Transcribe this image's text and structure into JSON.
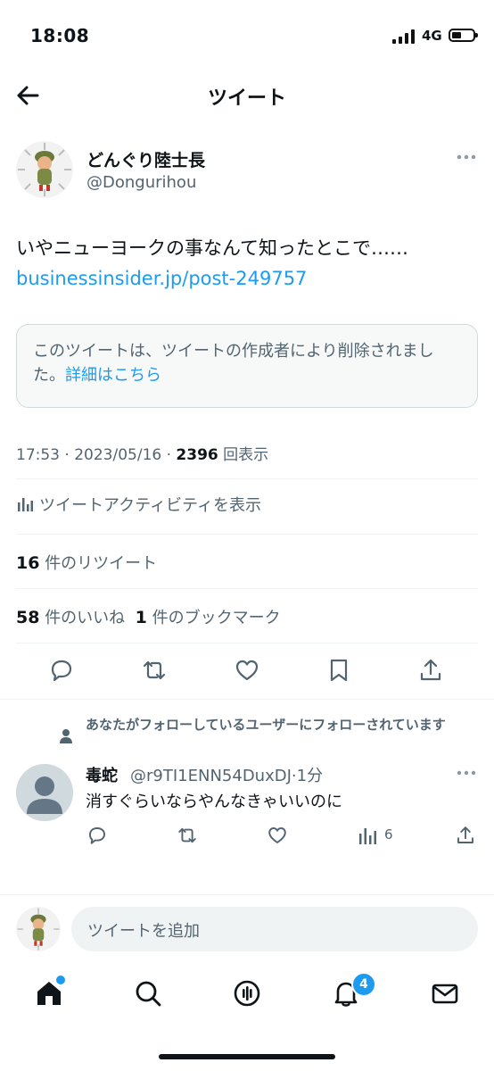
{
  "status_bar": {
    "time": "18:08",
    "network": "4G"
  },
  "header": {
    "title": "ツイート"
  },
  "tweet": {
    "author_name": "どんぐり陸士長",
    "author_handle": "@Dongurihou",
    "text": "いやニューヨークの事なんて知ったとこで……",
    "link": "businessinsider.jp/post-249757",
    "quoted_deleted": {
      "message": "このツイートは、ツイートの作成者により削除されました。",
      "details_link": "詳細はこちら"
    },
    "time": "17:53",
    "date": "2023/05/16",
    "views_count": "2396",
    "views_label": "回表示",
    "activity_label": "ツイートアクティビティを表示",
    "retweets_count": "16",
    "retweets_label": "件のリツイート",
    "likes_count": "58",
    "likes_label": "件のいいね",
    "bookmarks_count": "1",
    "bookmarks_label": "件のブックマーク"
  },
  "reply": {
    "social_context": "あなたがフォローしているユーザーにフォローされています",
    "name": "毒蛇",
    "handle": "@r9TI1ENN54DuxDJ",
    "time": "1分",
    "text": "消すぐらいならやんなきゃいいのに",
    "views": "6"
  },
  "compose": {
    "placeholder": "ツイートを追加"
  },
  "nav": {
    "notifications_badge": "4"
  },
  "colors": {
    "accent": "#1d9bf0",
    "text": "#0f1419",
    "muted": "#536471"
  }
}
